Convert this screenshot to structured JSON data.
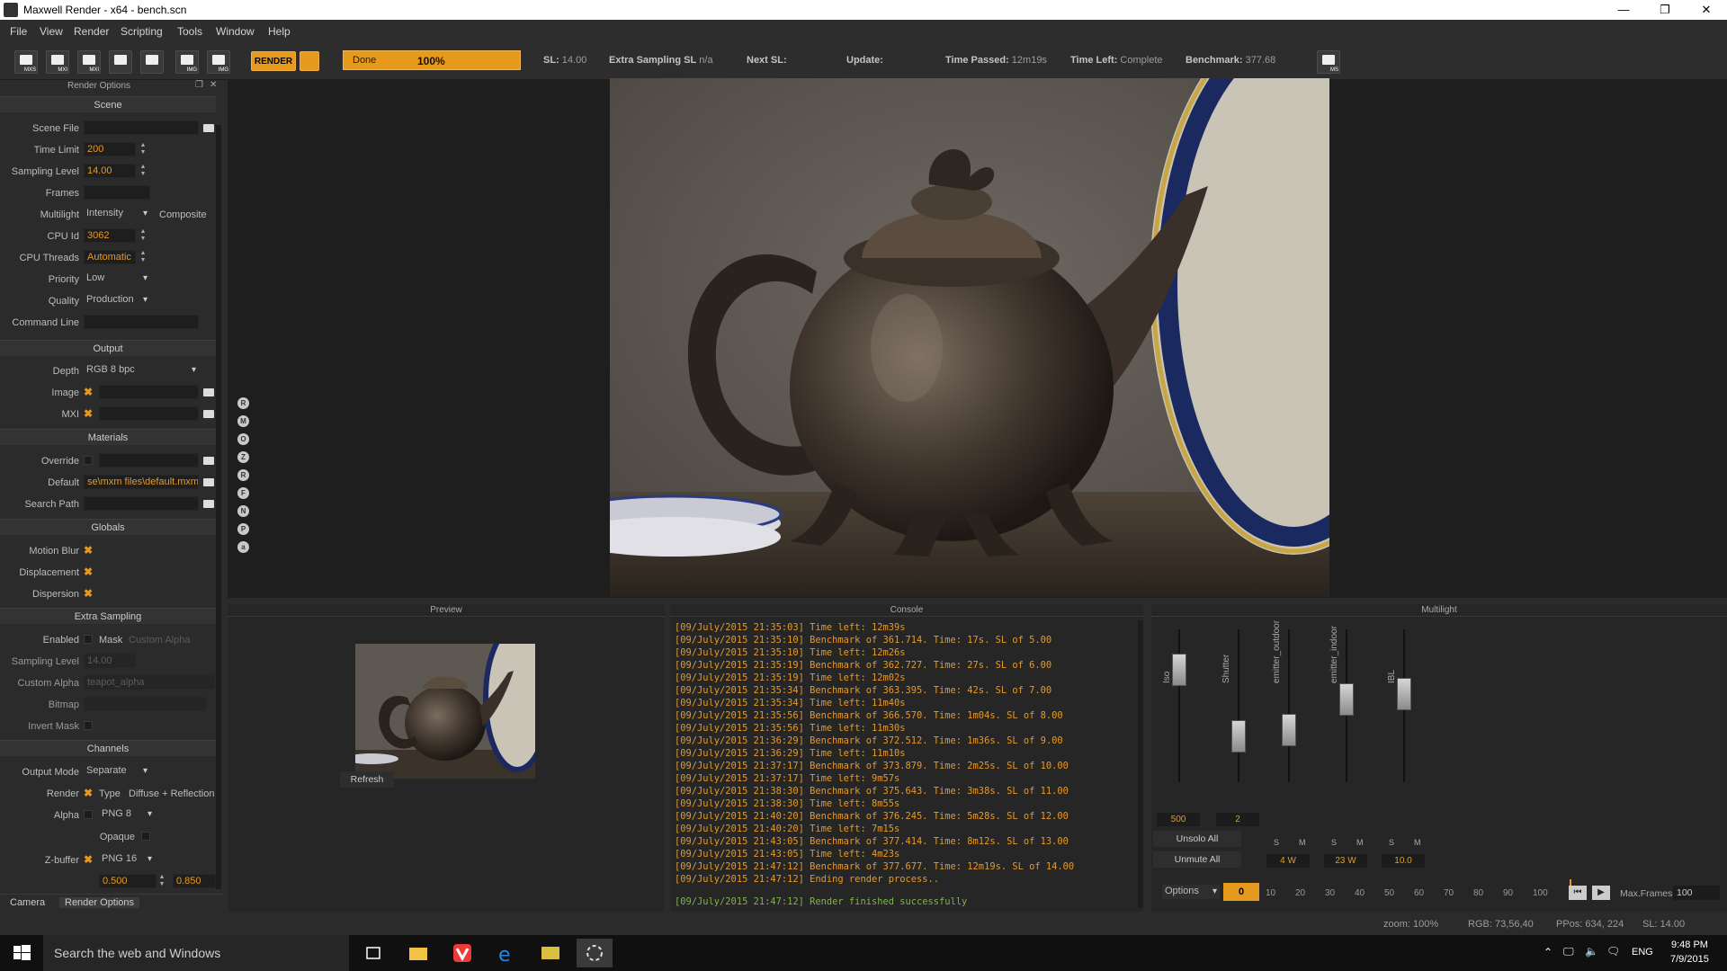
{
  "window": {
    "title": "Maxwell Render  -  x64 - bench.scn",
    "min": "—",
    "max": "❐",
    "close": "✕"
  },
  "menu": [
    "File",
    "View",
    "Render",
    "Scripting",
    "Tools",
    "Window",
    "Help"
  ],
  "toolbar": {
    "icons": [
      "MXS",
      "MXI",
      "MXI",
      "",
      "",
      "IMG",
      "IMG"
    ],
    "render_label": "RENDER",
    "progress_status": "Done",
    "progress_percent": "100%",
    "progress_fraction": 1.0,
    "sl_label": "SL:",
    "sl_value": "14.00",
    "extra_sampling_label": "Extra Sampling SL",
    "extra_sampling_value": "n/a",
    "next_sl_label": "Next SL:",
    "update_label": "Update:",
    "time_passed_label": "Time Passed:",
    "time_passed_value": "12m19s",
    "time_left_label": "Time Left:",
    "time_left_value": "Complete",
    "benchmark_label": "Benchmark:",
    "benchmark_value": "377.68",
    "ms_icon": "MS"
  },
  "render_options": {
    "header": "Render Options",
    "scene": {
      "title": "Scene",
      "scene_file_label": "Scene File",
      "scene_file": "",
      "time_limit_label": "Time Limit",
      "time_limit": "200",
      "sampling_level_label": "Sampling Level",
      "sampling_level": "14.00",
      "frames_label": "Frames",
      "frames": "",
      "multilight_label": "Multilight",
      "multilight": "Intensity",
      "composite": "Composite",
      "cpu_id_label": "CPU Id",
      "cpu_id": "3062",
      "cpu_threads_label": "CPU Threads",
      "cpu_threads": "Automatic",
      "priority_label": "Priority",
      "priority": "Low",
      "quality_label": "Quality",
      "quality": "Production",
      "command_line_label": "Command Line",
      "command_line": ""
    },
    "output": {
      "title": "Output",
      "depth_label": "Depth",
      "depth": "RGB  8 bpc",
      "image_label": "Image",
      "mxi_label": "MXI"
    },
    "materials": {
      "title": "Materials",
      "override_label": "Override",
      "default_label": "Default",
      "default": "se\\mxm files\\default.mxm",
      "search_path_label": "Search Path"
    },
    "globals": {
      "title": "Globals",
      "motion_blur": "Motion Blur",
      "displacement": "Displacement",
      "dispersion": "Dispersion"
    },
    "extra_sampling": {
      "title": "Extra Sampling",
      "enabled_label": "Enabled",
      "mask_label": "Mask",
      "mask_value": "Custom Alpha",
      "sampling_level_label": "Sampling Level",
      "sampling_level": "14.00",
      "custom_alpha_label": "Custom Alpha",
      "custom_alpha": "teapot_alpha",
      "bitmap_label": "Bitmap",
      "invert_mask_label": "Invert Mask"
    },
    "channels": {
      "title": "Channels",
      "output_mode_label": "Output Mode",
      "output_mode": "Separate",
      "render_label": "Render",
      "type_label": "Type",
      "type_value": "Diffuse + Reflection",
      "alpha_label": "Alpha",
      "alpha_format": "PNG 8",
      "opaque_label": "Opaque",
      "zbuffer_label": "Z-buffer",
      "zbuffer_format": "PNG 16",
      "z_min": "0.500",
      "z_max": "0.850"
    },
    "tabs": [
      "Camera",
      "Render Options"
    ]
  },
  "viewport_icons": [
    "R",
    "M",
    "O",
    "Z",
    "R",
    "F",
    "N",
    "P",
    "a"
  ],
  "preview": {
    "title": "Preview",
    "refresh": "Refresh"
  },
  "console": {
    "title": "Console",
    "lines": [
      "[09/July/2015 21:35:03] Time left: 12m39s",
      "[09/July/2015 21:35:10] Benchmark of 361.714. Time: 17s. SL of 5.00",
      "[09/July/2015 21:35:10] Time left: 12m26s",
      "[09/July/2015 21:35:19] Benchmark of 362.727. Time: 27s. SL of 6.00",
      "[09/July/2015 21:35:19] Time left: 12m02s",
      "[09/July/2015 21:35:34] Benchmark of 363.395. Time: 42s. SL of 7.00",
      "[09/July/2015 21:35:34] Time left: 11m40s",
      "[09/July/2015 21:35:56] Benchmark of 366.570. Time: 1m04s. SL of 8.00",
      "[09/July/2015 21:35:56] Time left: 11m30s",
      "[09/July/2015 21:36:29] Benchmark of 372.512. Time: 1m36s. SL of 9.00",
      "[09/July/2015 21:36:29] Time left: 11m10s",
      "[09/July/2015 21:37:17] Benchmark of 373.879. Time: 2m25s. SL of 10.00",
      "[09/July/2015 21:37:17] Time left: 9m57s",
      "[09/July/2015 21:38:30] Benchmark of 375.643. Time: 3m38s. SL of 11.00",
      "[09/July/2015 21:38:30] Time left: 8m55s",
      "[09/July/2015 21:40:20] Benchmark of 376.245. Time: 5m28s. SL of 12.00",
      "[09/July/2015 21:40:20] Time left: 7m15s",
      "[09/July/2015 21:43:05] Benchmark of 377.414. Time: 8m12s. SL of 13.00",
      "[09/July/2015 21:43:05] Time left: 4m23s",
      "[09/July/2015 21:47:12] Benchmark of 377.677. Time: 12m19s. SL of 14.00",
      "[09/July/2015 21:47:12] Ending render process.."
    ],
    "final_line": "[09/July/2015 21:47:12] Render finished successfully"
  },
  "multilight": {
    "title": "Multilight",
    "channels": [
      {
        "name": "Iso",
        "value": "500",
        "level": 0.8
      },
      {
        "name": "Shutter",
        "value": "2",
        "level": 0.25
      },
      {
        "name": "emitter_outdoor",
        "value": "4",
        "unit": "W",
        "level": 0.3
      },
      {
        "name": "emitter_indoor",
        "value": "23",
        "unit": "W",
        "level": 0.55
      },
      {
        "name": "IBL",
        "value": "10.0",
        "level": 0.6
      }
    ],
    "unsolo_all": "Unsolo All",
    "unmute_all": "Unmute All",
    "s_label": "S",
    "m_label": "M",
    "options": "Options",
    "frame_value": "0",
    "ticks": [
      "10",
      "20",
      "30",
      "40",
      "50",
      "60",
      "70",
      "80",
      "90",
      "100"
    ],
    "max_frames_label": "Max.Frames",
    "max_frames_value": "100"
  },
  "statusbar": {
    "zoom": "zoom: 100%",
    "rgb": "RGB: 73,56,40",
    "ppos": "PPos: 634, 224",
    "sl": "SL: 14.00"
  },
  "taskbar": {
    "search_placeholder": "Search the web and Windows",
    "lang": "ENG",
    "time": "9:48 PM",
    "date": "7/9/2015"
  },
  "colors": {
    "accent": "#e69a1d",
    "console_text": "#e59a28",
    "console_success": "#7fb44a"
  }
}
